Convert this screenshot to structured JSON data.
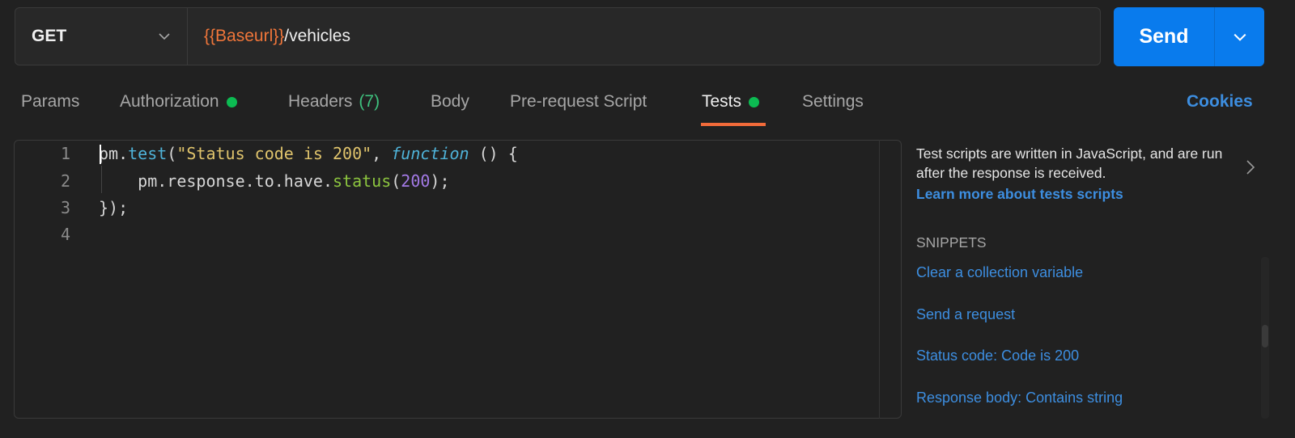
{
  "request": {
    "method": "GET",
    "url_variable": "{{Baseurl}}",
    "url_path": "/vehicles",
    "send_label": "Send"
  },
  "tabs": [
    {
      "label": "Params",
      "dot": false,
      "count": null,
      "active": false
    },
    {
      "label": "Authorization",
      "dot": true,
      "count": null,
      "active": false
    },
    {
      "label": "Headers",
      "dot": false,
      "count": "(7)",
      "active": false
    },
    {
      "label": "Body",
      "dot": false,
      "count": null,
      "active": false
    },
    {
      "label": "Pre-request Script",
      "dot": false,
      "count": null,
      "active": false
    },
    {
      "label": "Tests",
      "dot": true,
      "count": null,
      "active": true
    },
    {
      "label": "Settings",
      "dot": false,
      "count": null,
      "active": false
    }
  ],
  "cookies_label": "Cookies",
  "editor": {
    "line_numbers": [
      "1",
      "2",
      "3",
      "4"
    ],
    "lines": {
      "l1": {
        "obj": "pm.",
        "fn": "test",
        "open": "(",
        "str": "\"Status code is 200\"",
        "comma": ", ",
        "kw": "function",
        "rest": " () {"
      },
      "l2": {
        "indent": "    ",
        "chain": "pm.response.to.have.",
        "method": "status",
        "open": "(",
        "num": "200",
        "close": ");"
      },
      "l3": {
        "text": "});"
      }
    }
  },
  "side_panel": {
    "description": "Test scripts are written in JavaScript, and are run after the response is received.",
    "learn_more": "Learn more about tests scripts",
    "snippets_title": "SNIPPETS",
    "snippets": [
      "Clear a collection variable",
      "Send a request",
      "Status code: Code is 200",
      "Response body: Contains string"
    ]
  },
  "colors": {
    "accent": "#097bed",
    "tab_underline": "#f26b3a",
    "status_dot": "#0cbb52",
    "link": "#3d8ee0",
    "variable": "#f0763a"
  }
}
